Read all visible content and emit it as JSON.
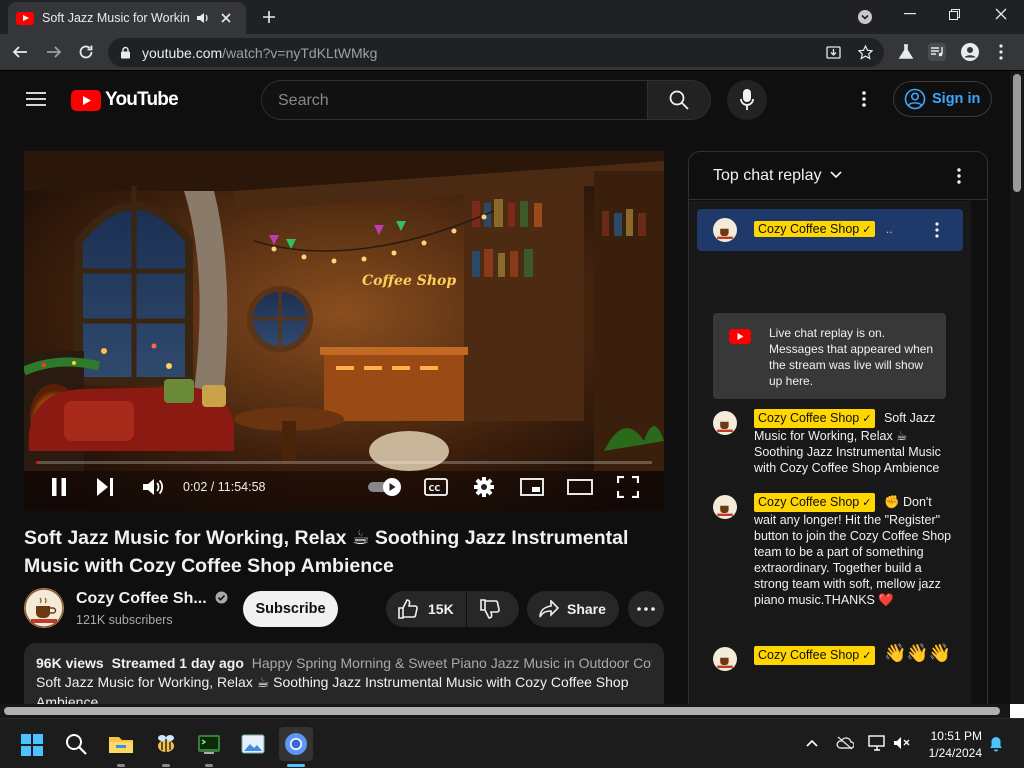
{
  "browser": {
    "tab_title": "Soft Jazz Music for Working, Relax",
    "url_domain": "youtube.com",
    "url_path": "/watch?v=nyTdKLtWMkg"
  },
  "masthead": {
    "logo_text": "YouTube",
    "search_placeholder": "Search",
    "signin_label": "Sign in",
    "accent_color": "#3ea6ff"
  },
  "player": {
    "current_time": "0:02",
    "duration": "11:54:58",
    "time_display": "0:02 / 11:54:58",
    "progress_fraction": 0.0001,
    "overlay_sign": "Coffee Shop"
  },
  "video": {
    "title": "Soft Jazz Music for Working, Relax ☕ Soothing Jazz Instrumental Music with Cozy Coffee Shop Ambience",
    "channel_name": "Cozy Coffee Sh...",
    "subscribers": "121K subscribers",
    "subscribe_label": "Subscribe",
    "likes": "15K",
    "share_label": "Share",
    "views": "96K views",
    "streamed": "Streamed 1 day ago",
    "tags": "Happy Spring Morning & Sweet Piano Jazz Music in Outdoor Coffe",
    "description": "Soft Jazz Music for Working, Relax ☕ Soothing Jazz Instrumental Music with Cozy Coffee Shop Ambience"
  },
  "chat": {
    "header": "Top chat replay",
    "pinned_author": "Cozy Coffee Shop",
    "pinned_text": "..",
    "notice": "Live chat replay is on. Messages that appeared when the stream was live will show up here.",
    "messages": [
      {
        "author": "Cozy Coffee Shop",
        "text": "Soft Jazz Music for Working, Relax ☕ Soothing Jazz Instrumental Music with Cozy Coffee Shop Ambience"
      },
      {
        "author": "Cozy Coffee Shop",
        "text": "✊ Don't wait any longer! Hit the \"Register\" button to join the Cozy Coffee Shop team to be a part of something extraordinary. Together build a strong team with soft, mellow jazz piano music.THANKS ❤️"
      },
      {
        "author": "Cozy Coffee Shop",
        "text": "👋👋👋"
      }
    ],
    "author_badge_color": "#ffd600"
  },
  "taskbar": {
    "time": "10:51 PM",
    "date": "1/24/2024"
  }
}
